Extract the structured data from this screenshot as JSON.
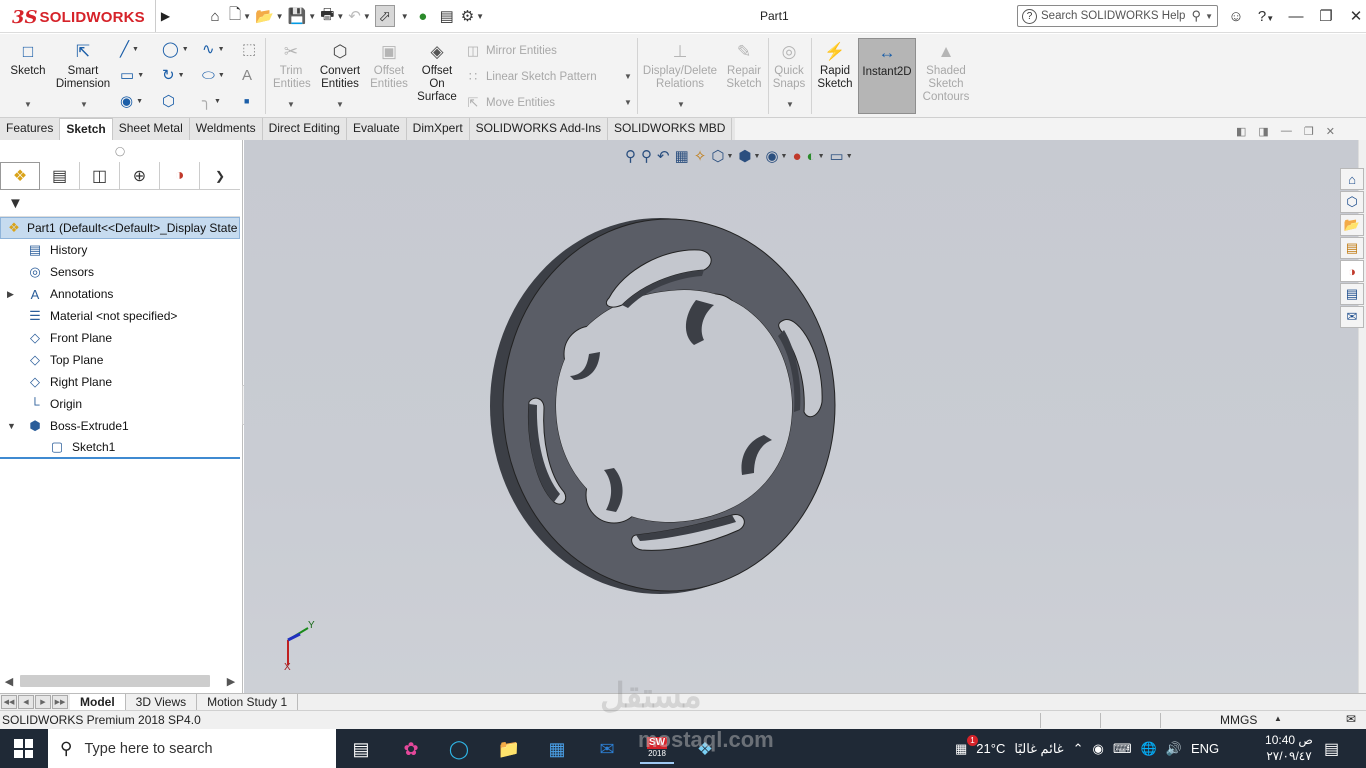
{
  "app": {
    "logo_ds": "3S",
    "logo_word": "SOLIDWORKS",
    "doc_title": "Part1",
    "help_search_placeholder": "Search SOLIDWORKS Help",
    "window_controls": [
      "person",
      "help",
      "minimize",
      "restore",
      "close"
    ]
  },
  "commands": {
    "sketch": "Sketch",
    "smart_dimension": "Smart Dimension",
    "trim_entities": "Trim Entities",
    "convert_entities": "Convert Entities",
    "offset_entities": "Offset Entities",
    "offset_on_surface": "Offset On Surface",
    "mirror_entities": "Mirror Entities",
    "linear_sketch_pattern": "Linear Sketch Pattern",
    "move_entities": "Move Entities",
    "display_delete_relations": "Display/Delete Relations",
    "repair_sketch": "Repair Sketch",
    "quick_snaps": "Quick Snaps",
    "rapid_sketch": "Rapid Sketch",
    "instant2d": "Instant2D",
    "shaded_sketch_contours": "Shaded Sketch Contours"
  },
  "cmd_tabs": [
    "Features",
    "Sketch",
    "Sheet Metal",
    "Weldments",
    "Direct Editing",
    "Evaluate",
    "DimXpert",
    "SOLIDWORKS Add-Ins",
    "SOLIDWORKS MBD"
  ],
  "active_cmd_tab": "Sketch",
  "tree": {
    "root": "Part1  (Default<<Default>_Display State",
    "items": [
      {
        "label": "History",
        "icon": "history-icon"
      },
      {
        "label": "Sensors",
        "icon": "sensors-icon"
      },
      {
        "label": "Annotations",
        "icon": "annotations-icon"
      },
      {
        "label": "Material <not specified>",
        "icon": "material-icon"
      },
      {
        "label": "Front Plane",
        "icon": "plane-icon"
      },
      {
        "label": "Top Plane",
        "icon": "plane-icon"
      },
      {
        "label": "Right Plane",
        "icon": "plane-icon"
      },
      {
        "label": "Origin",
        "icon": "origin-icon"
      },
      {
        "label": "Boss-Extrude1",
        "icon": "extrude-icon"
      },
      {
        "label": "Sketch1",
        "icon": "sketch-icon"
      }
    ]
  },
  "triad": {
    "y": "Y",
    "x": "X"
  },
  "bottom_tabs": [
    "Model",
    "3D Views",
    "Motion Study 1"
  ],
  "active_bottom_tab": "Model",
  "status": {
    "product": "SOLIDWORKS Premium 2018 SP4.0",
    "units": "MMGS"
  },
  "taskbar": {
    "search_placeholder": "Type here to search",
    "sw_badge": "2018",
    "weather_temp": "21°C",
    "weather_text": "غائم غالبًا",
    "lang": "ENG",
    "time": "10:40 ص",
    "date": "٢٧/٠٩/٤٧",
    "notif_count": "1"
  },
  "watermark": {
    "ar": "مستقل",
    "en": "mostaql.com"
  }
}
